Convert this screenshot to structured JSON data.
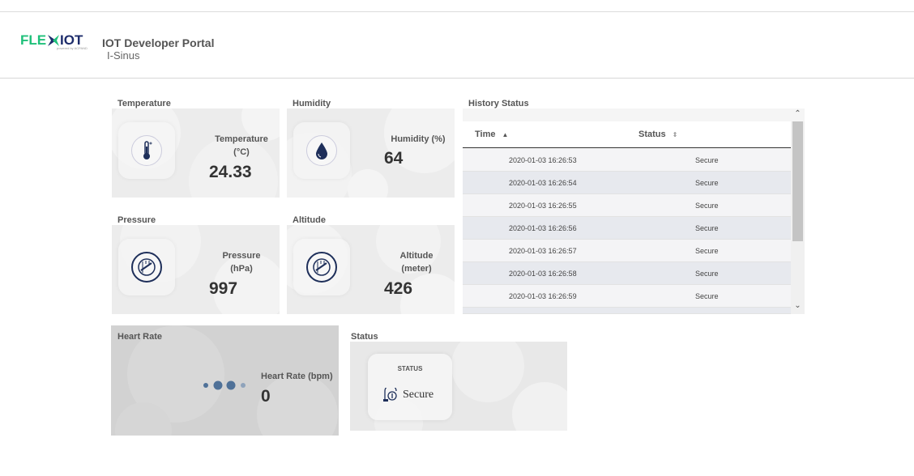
{
  "header": {
    "logo_text": "FLEXIOT",
    "logo_sub": "powered by ACPAND",
    "title": "IOT Developer Portal",
    "subtitle": "I-Sinus"
  },
  "cards": {
    "temperature": {
      "section": "Temperature",
      "label_line1": "Temperature",
      "label_line2": "(°C)",
      "value": "24.33",
      "icon": "thermometer-icon"
    },
    "humidity": {
      "section": "Humidity",
      "label_line1": "Humidity (%)",
      "value": "64",
      "icon": "water-drop-icon"
    },
    "pressure": {
      "section": "Pressure",
      "label_line1": "Pressure",
      "label_line2": "(hPa)",
      "value": "997",
      "icon": "gauge-icon"
    },
    "altitude": {
      "section": "Altitude",
      "label_line1": "Altitude",
      "label_line2": "(meter)",
      "value": "426",
      "icon": "gauge-icon"
    },
    "heart_rate": {
      "section": "Heart Rate",
      "label_line1": "Heart Rate (bpm)",
      "value": "0",
      "icon": "loading-dots-icon"
    },
    "status": {
      "section": "Status",
      "heading": "STATUS",
      "value": "Secure",
      "icon": "fingerprint-icon"
    }
  },
  "history": {
    "section": "History Status",
    "columns": [
      "Time",
      "Status"
    ],
    "sort_icons": [
      "sort-asc-icon",
      "sort-both-icon"
    ],
    "rows": [
      {
        "time": "2020-01-03 16:26:53",
        "status": "Secure"
      },
      {
        "time": "2020-01-03 16:26:54",
        "status": "Secure"
      },
      {
        "time": "2020-01-03 16:26:55",
        "status": "Secure"
      },
      {
        "time": "2020-01-03 16:26:56",
        "status": "Secure"
      },
      {
        "time": "2020-01-03 16:26:57",
        "status": "Secure"
      },
      {
        "time": "2020-01-03 16:26:58",
        "status": "Secure"
      },
      {
        "time": "2020-01-03 16:26:59",
        "status": "Secure"
      }
    ]
  },
  "colors": {
    "logo_green": "#1fc07a",
    "logo_navy": "#1d2c6b",
    "icon_navy": "#1e2f5a",
    "dots": "#4f7198"
  }
}
